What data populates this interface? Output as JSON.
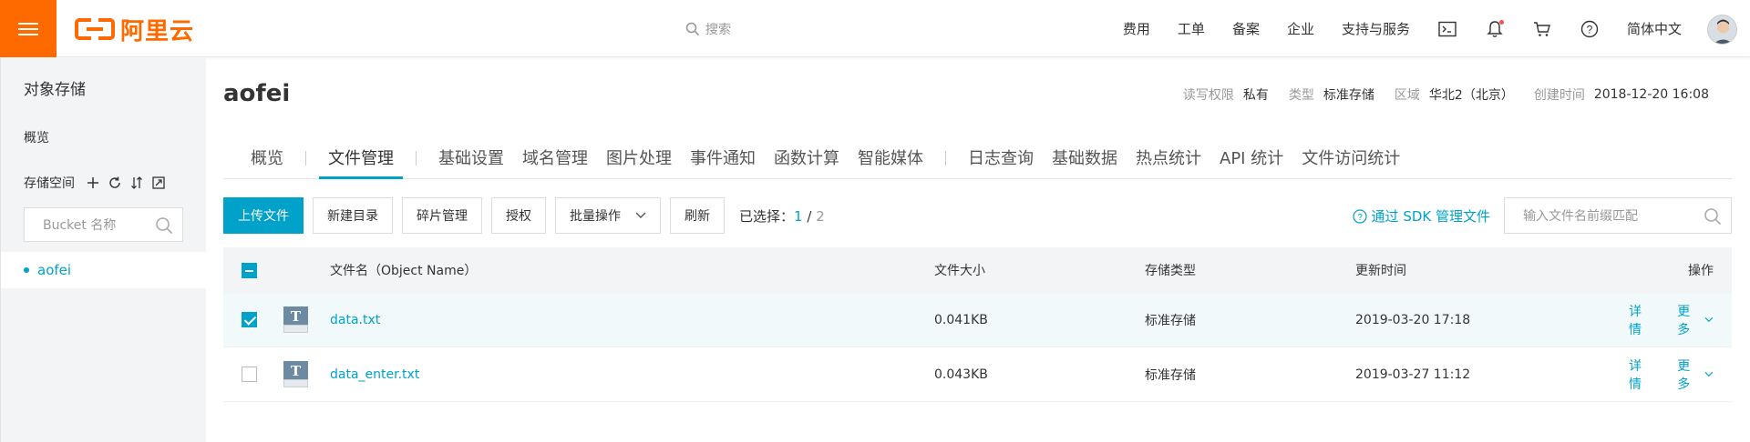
{
  "header": {
    "logo_text": "阿里云",
    "search_placeholder": "搜索",
    "nav": [
      "费用",
      "工单",
      "备案",
      "企业",
      "支持与服务"
    ],
    "language": "简体中文",
    "icons": [
      "terminal-icon",
      "bell-icon",
      "cart-icon",
      "help-icon"
    ],
    "accent_color": "#ff6a00"
  },
  "sidebar": {
    "title": "对象存储",
    "overview": "概览",
    "storage_space_label": "存储空间",
    "bucket_search_placeholder": "Bucket 名称",
    "buckets": [
      "aofei"
    ]
  },
  "bucket": {
    "name": "aofei",
    "meta": [
      {
        "key": "读写权限",
        "value": "私有"
      },
      {
        "key": "类型",
        "value": "标准存储"
      },
      {
        "key": "区域",
        "value": "华北2（北京）"
      },
      {
        "key": "创建时间",
        "value": "2018-12-20 16:08"
      }
    ]
  },
  "tabs": {
    "groups": [
      [
        "概览"
      ],
      [
        "文件管理"
      ],
      [
        "基础设置",
        "域名管理",
        "图片处理",
        "事件通知",
        "函数计算",
        "智能媒体"
      ],
      [
        "日志查询",
        "基础数据",
        "热点统计",
        "API 统计",
        "文件访问统计"
      ]
    ],
    "active": "文件管理"
  },
  "toolbar": {
    "upload": "上传文件",
    "new_dir": "新建目录",
    "fragment": "碎片管理",
    "authorize": "授权",
    "batch": "批量操作",
    "refresh": "刷新",
    "selected_label": "已选择：",
    "selected_count": "1",
    "separator": "/",
    "total_count": "2",
    "sdk_link": "通过 SDK 管理文件",
    "file_search_placeholder": "输入文件名前缀匹配"
  },
  "table": {
    "headers": {
      "name": "文件名（Object Name）",
      "size": "文件大小",
      "type": "存储类型",
      "time": "更新时间",
      "ops": "操作"
    },
    "rows": [
      {
        "name": "data.txt",
        "size": "0.041KB",
        "type": "标准存储",
        "time": "2019-03-20 17:18",
        "detail": "详情",
        "more": "更多",
        "checked": true
      },
      {
        "name": "data_enter.txt",
        "size": "0.043KB",
        "type": "标准存储",
        "time": "2019-03-27 11:12",
        "detail": "详情",
        "more": "更多",
        "checked": false
      }
    ]
  },
  "colors": {
    "primary": "#00a2ca",
    "brand": "#ff6a00"
  }
}
